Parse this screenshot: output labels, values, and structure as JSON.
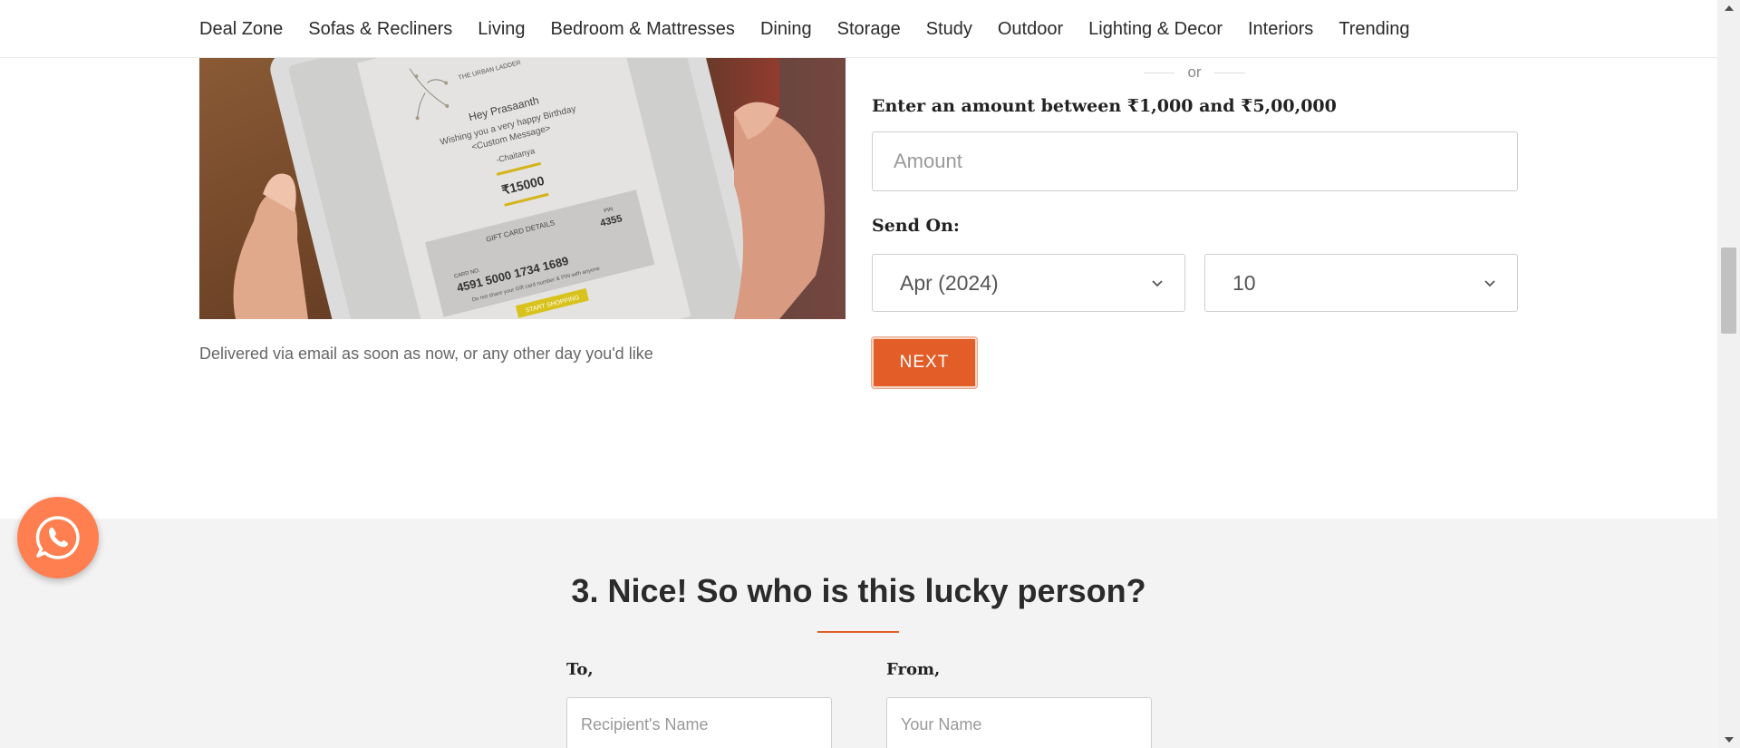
{
  "nav": {
    "items": [
      "Deal Zone",
      "Sofas & Recliners",
      "Living",
      "Bedroom & Mattresses",
      "Dining",
      "Storage",
      "Study",
      "Outdoor",
      "Lighting & Decor",
      "Interiors",
      "Trending"
    ]
  },
  "gift_card_image": {
    "greeting": "Hey Prasaanth",
    "wish_line1": "Wishing you a very happy Birthday",
    "wish_line2": "<Custom Message>",
    "signature": "-Chaitanya",
    "amount": "₹15000",
    "details_title": "GIFT CARD DETAILS",
    "pin_label": "PIN",
    "pin": "4355",
    "card_no_label": "CARD NO.",
    "card_no": "4591 5000 1734 1689",
    "warning": "Do not share your Gift card number & PIN with anyone",
    "cta": "START SHOPPING",
    "brand": "THE URBAN LADDER"
  },
  "delivery_note": "Delivered via email as soon as now, or any other day you'd like",
  "amount_form": {
    "or_text": "or",
    "label": "Enter an amount between ₹1,000 and  ₹5,00,000",
    "placeholder": "Amount",
    "send_on_label": "Send On:",
    "month_value": "Apr (2024)",
    "day_value": "10",
    "next_label": "NEXT"
  },
  "recipient_section": {
    "title": "3. Nice! So who is this lucky person?",
    "to_label": "To,",
    "to_placeholder": "Recipient's Name",
    "from_label": "From,",
    "from_placeholder": "Your Name"
  },
  "colors": {
    "accent": "#e25d27",
    "whatsapp_button": "#ff7f50",
    "section_bg": "#f3f3f3"
  },
  "icons": {
    "whatsapp": "whatsapp-icon",
    "dropdown": "chevron-down-icon"
  }
}
